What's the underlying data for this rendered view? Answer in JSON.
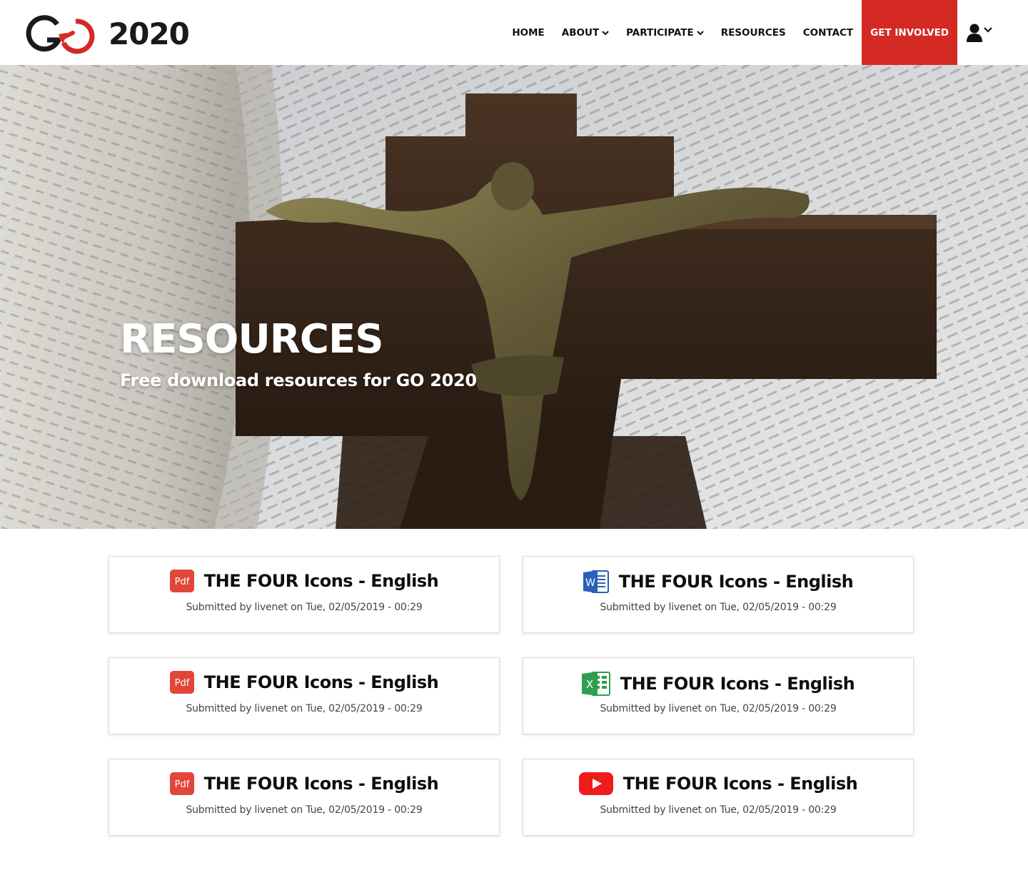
{
  "brand": {
    "logo_text": "2020",
    "accent": "#d52a24"
  },
  "nav": {
    "items": [
      {
        "label": "HOME",
        "dropdown": false
      },
      {
        "label": "ABOUT",
        "dropdown": true
      },
      {
        "label": "PARTICIPATE",
        "dropdown": true
      },
      {
        "label": "RESOURCES",
        "dropdown": false
      },
      {
        "label": "CONTACT",
        "dropdown": false
      }
    ],
    "cta_label": "GET INVOLVED",
    "user_icon": "user-icon"
  },
  "hero": {
    "title": "RESOURCES",
    "subtitle": "Free download resources for GO 2020"
  },
  "resources": [
    {
      "type": "pdf",
      "icon": "pdf-icon",
      "title": "THE FOUR Icons - English",
      "meta": "Submitted by livenet on Tue, 02/05/2019 - 00:29"
    },
    {
      "type": "word",
      "icon": "word-icon",
      "title": "THE FOUR Icons - English",
      "meta": "Submitted by livenet on Tue, 02/05/2019 - 00:29"
    },
    {
      "type": "pdf",
      "icon": "pdf-icon",
      "title": "THE FOUR Icons - English",
      "meta": "Submitted by livenet on Tue, 02/05/2019 - 00:29"
    },
    {
      "type": "excel",
      "icon": "excel-icon",
      "title": "THE FOUR Icons - English",
      "meta": "Submitted by livenet on Tue, 02/05/2019 - 00:29"
    },
    {
      "type": "pdf",
      "icon": "pdf-icon",
      "title": "THE FOUR Icons - English",
      "meta": "Submitted by livenet on Tue, 02/05/2019 - 00:29"
    },
    {
      "type": "youtube",
      "icon": "youtube-icon",
      "title": "THE FOUR Icons - English",
      "meta": "Submitted by livenet on Tue, 02/05/2019 - 00:29"
    }
  ]
}
